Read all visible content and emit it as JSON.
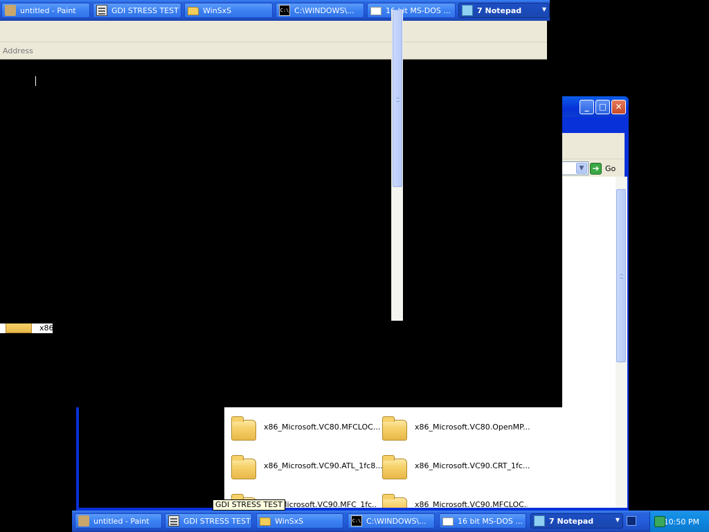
{
  "top_taskbar": {
    "buttons": [
      {
        "label": "untitled - Paint",
        "icon": "paint-icon"
      },
      {
        "label": "GDI STRESS TEST",
        "icon": "gdi-app-icon"
      },
      {
        "label": "WinSxS",
        "icon": "folder-icon"
      },
      {
        "label": "C:\\WINDOWS\\...",
        "icon": "cmd-icon"
      },
      {
        "label": "16 bit MS-DOS ...",
        "icon": "dos-window-icon"
      },
      {
        "label": "7 Notepad",
        "icon": "notepad-icon",
        "active": true
      }
    ]
  },
  "explorer_top": {
    "address_label": "Address"
  },
  "explorer_right": {
    "go_label": "Go"
  },
  "stray_icon_label": "x86",
  "folders": [
    {
      "name": "x86_Microsoft.VC80.MFCLOC..."
    },
    {
      "name": "x86_Microsoft.VC80.OpenMP..."
    },
    {
      "name": "x86_Microsoft.VC90.ATL_1fc8..."
    },
    {
      "name": "x86_Microsoft.VC90.CRT_1fc..."
    },
    {
      "name": "Microsoft.VC90.MFC_1fc..."
    },
    {
      "name": "x86_Microsoft.VC90.MFCLOC..."
    }
  ],
  "tooltip": "GDI STRESS TEST",
  "bottom_taskbar": {
    "buttons": [
      {
        "label": "untitled - Paint",
        "icon": "paint-icon"
      },
      {
        "label": "GDI STRESS TEST",
        "icon": "gdi-app-icon"
      },
      {
        "label": "WinSxS",
        "icon": "folder-icon"
      },
      {
        "label": "C:\\WINDOWS\\...",
        "icon": "cmd-icon"
      },
      {
        "label": "16 bit MS-DOS ...",
        "icon": "dos-window-icon"
      },
      {
        "label": "7 Notepad",
        "icon": "notepad-icon",
        "active": true
      }
    ],
    "clock": "10:50 PM"
  },
  "colors": {
    "taskbar_blue": "#245edb",
    "tray_blue": "#0f86e0",
    "desktop_black": "#000000",
    "window_frame_blue": "#0831d9",
    "explorer_bg": "#ece9d8"
  }
}
